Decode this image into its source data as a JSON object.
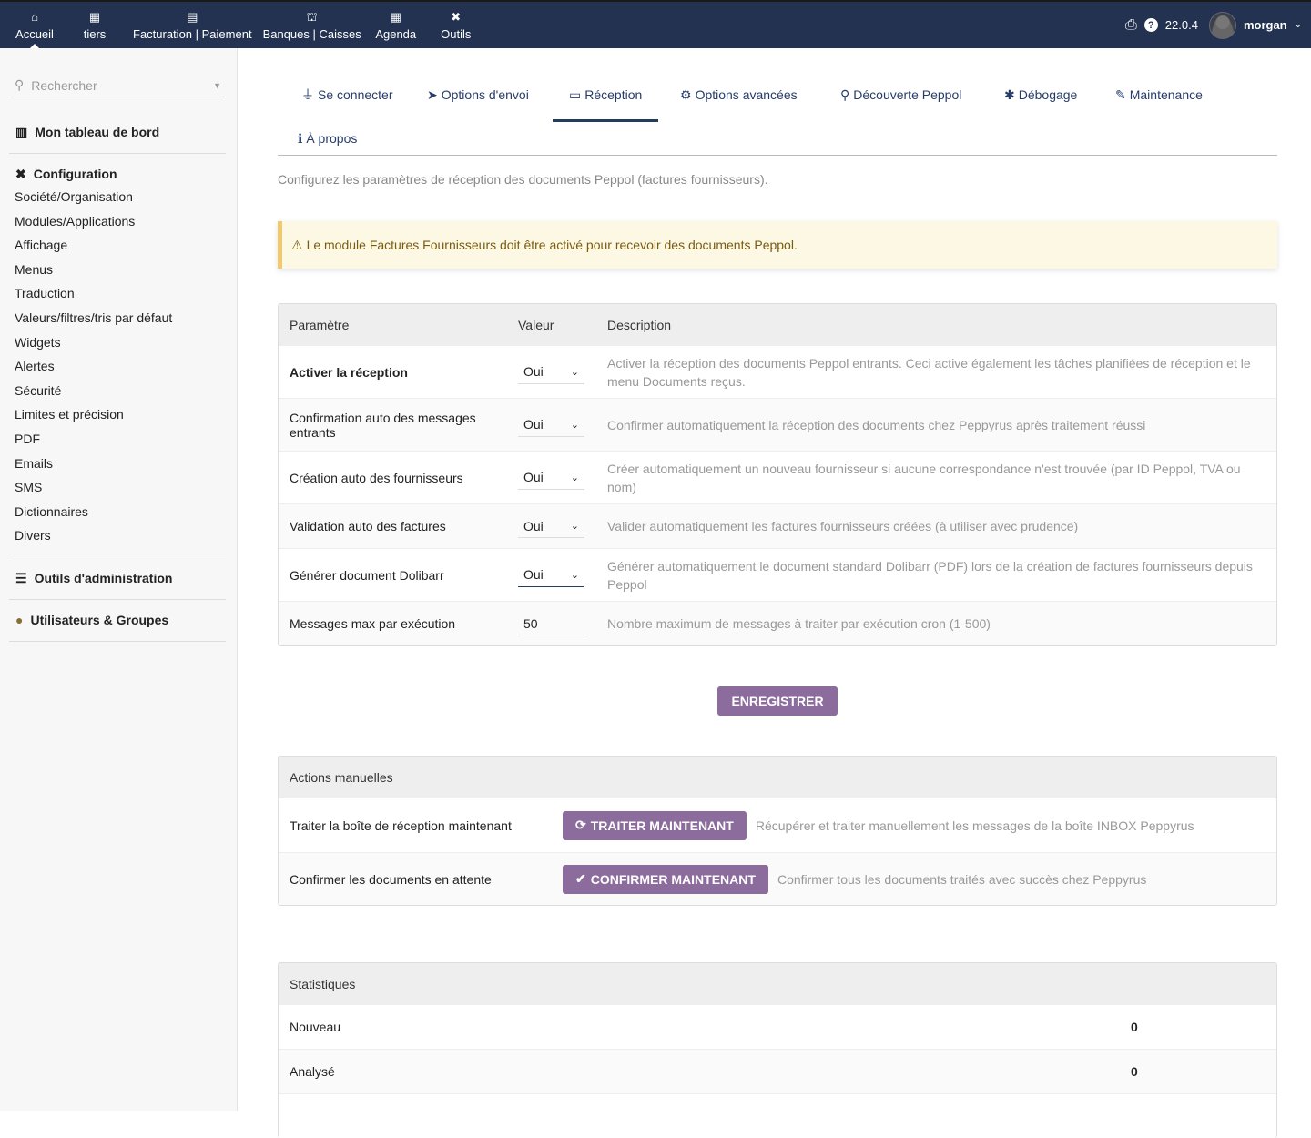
{
  "topnav": {
    "items": [
      {
        "label": "Accueil",
        "icon": "home-icon",
        "glyph": "⌂"
      },
      {
        "label": "tiers",
        "icon": "building-icon",
        "glyph": "▦"
      },
      {
        "label": "Facturation | Paiement",
        "icon": "invoice-icon",
        "glyph": "▤"
      },
      {
        "label": "Banques | Caisses",
        "icon": "bank-icon",
        "glyph": "⛫"
      },
      {
        "label": "Agenda",
        "icon": "calendar-icon",
        "glyph": "▦"
      },
      {
        "label": "Outils",
        "icon": "tools-icon",
        "glyph": "✖"
      }
    ],
    "version": "22.0.4",
    "user": "morgan"
  },
  "sidebar": {
    "search_placeholder": "Rechercher",
    "dashboard": "Mon tableau de bord",
    "config": "Configuration",
    "config_items": [
      "Société/Organisation",
      "Modules/Applications",
      "Affichage",
      "Menus",
      "Traduction",
      "Valeurs/filtres/tris par défaut",
      "Widgets",
      "Alertes",
      "Sécurité",
      "Limites et précision",
      "PDF",
      "Emails",
      "SMS",
      "Dictionnaires",
      "Divers"
    ],
    "admin": "Outils d'administration",
    "users": "Utilisateurs & Groupes"
  },
  "tabs": [
    {
      "label": "Se connecter",
      "glyph": "⏚"
    },
    {
      "label": "Options d'envoi",
      "glyph": "➤"
    },
    {
      "label": "Réception",
      "glyph": "▭"
    },
    {
      "label": "Options avancées",
      "glyph": "⚙"
    },
    {
      "label": "Découverte Peppol",
      "glyph": "⚲"
    },
    {
      "label": "Débogage",
      "glyph": "✱"
    },
    {
      "label": "Maintenance",
      "glyph": "✎"
    },
    {
      "label": "À propos",
      "glyph": "ℹ"
    }
  ],
  "intro": "Configurez les paramètres de réception des documents Peppol (factures fournisseurs).",
  "warning": "Le module Factures Fournisseurs doit être activé pour recevoir des documents Peppol.",
  "params": {
    "headers": [
      "Paramètre",
      "Valeur",
      "Description"
    ],
    "rows": [
      {
        "name": "Activer la réception",
        "value": "Oui",
        "desc": "Activer la réception des documents Peppol entrants. Ceci active également les tâches planifiées de réception et le menu Documents reçus."
      },
      {
        "name": "Confirmation auto des messages entrants",
        "value": "Oui",
        "desc": "Confirmer automatiquement la réception des documents chez Peppyrus après traitement réussi"
      },
      {
        "name": "Création auto des fournisseurs",
        "value": "Oui",
        "desc": "Créer automatiquement un nouveau fournisseur si aucune correspondance n'est trouvée (par ID Peppol, TVA ou nom)"
      },
      {
        "name": "Validation auto des factures",
        "value": "Oui",
        "desc": "Valider automatiquement les factures fournisseurs créées (à utiliser avec prudence)"
      },
      {
        "name": "Générer document Dolibarr",
        "value": "Oui",
        "desc": "Générer automatiquement le document standard Dolibarr (PDF) lors de la création de factures fournisseurs depuis Peppol"
      },
      {
        "name": "Messages max par exécution",
        "value": "50",
        "desc": "Nombre maximum de messages à traiter par exécution cron (1-500)"
      }
    ]
  },
  "save": "ENREGISTRER",
  "manual": {
    "title": "Actions manuelles",
    "rows": [
      {
        "label": "Traiter la boîte de réception maintenant",
        "button": "TRAITER MAINTENANT",
        "desc": "Récupérer et traiter manuellement les messages de la boîte INBOX Peppyrus"
      },
      {
        "label": "Confirmer les documents en attente",
        "button": "CONFIRMER MAINTENANT",
        "desc": "Confirmer tous les documents traités avec succès chez Peppyrus"
      }
    ]
  },
  "stats": {
    "title": "Statistiques",
    "rows": [
      {
        "label": "Nouveau",
        "value": "0"
      },
      {
        "label": "Analysé",
        "value": "0"
      }
    ]
  }
}
